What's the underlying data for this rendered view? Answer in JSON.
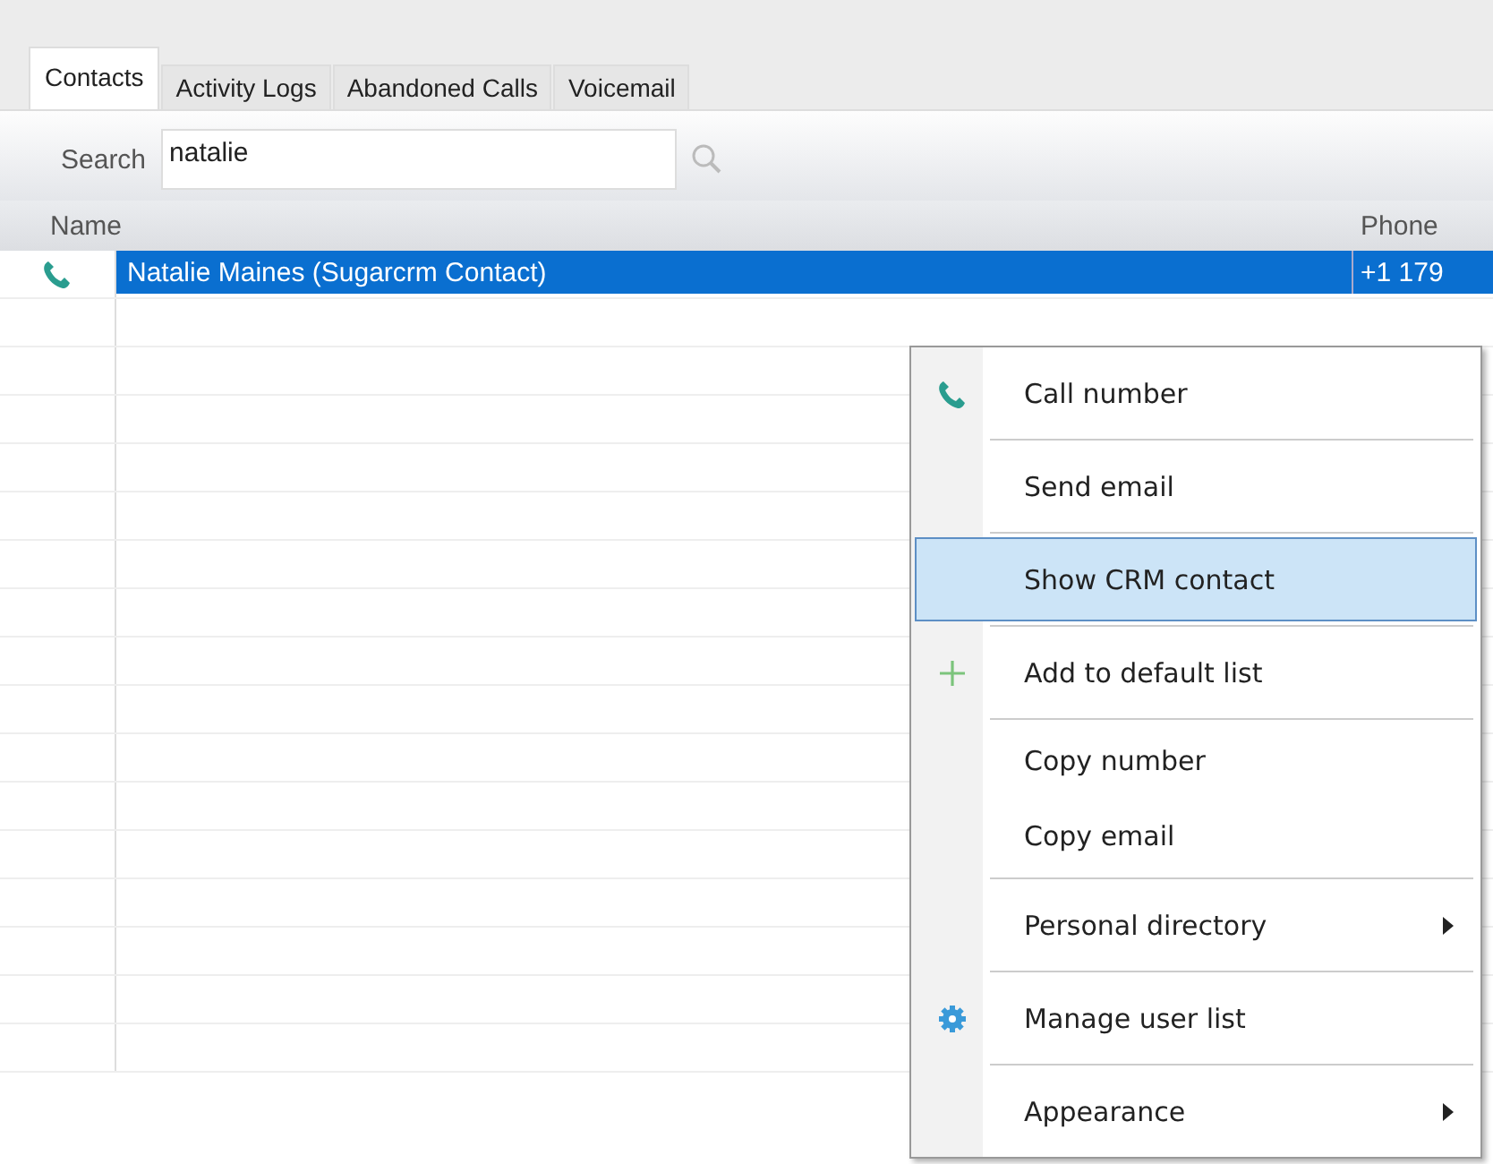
{
  "tabs": [
    {
      "label": "Contacts",
      "selected": true
    },
    {
      "label": "Activity Logs",
      "selected": false
    },
    {
      "label": "Abandoned Calls",
      "selected": false
    },
    {
      "label": "Voicemail",
      "selected": false
    }
  ],
  "search": {
    "label": "Search",
    "value": "natalie"
  },
  "table": {
    "columns": [
      "Name",
      "Phone"
    ],
    "rows": [
      {
        "name": "Natalie Maines (Sugarcrm Contact)",
        "phone": "+1 179",
        "selected": true
      }
    ]
  },
  "context_menu": {
    "groups": [
      [
        {
          "label": "Call number",
          "kind": "phone",
          "selected": false,
          "submenu": false
        }
      ],
      [
        {
          "label": "Send email",
          "kind": "plain",
          "selected": false,
          "submenu": false
        }
      ],
      [
        {
          "label": "Show CRM contact",
          "kind": "plain",
          "selected": true,
          "submenu": false
        }
      ],
      [
        {
          "label": "Add to default list",
          "kind": "plus",
          "selected": false,
          "submenu": false
        }
      ],
      [
        {
          "label": "Copy number",
          "kind": "plain",
          "selected": false,
          "submenu": false
        },
        {
          "label": "Copy email",
          "kind": "plain",
          "selected": false,
          "submenu": false
        }
      ],
      [
        {
          "label": "Personal directory",
          "kind": "plain",
          "selected": false,
          "submenu": true
        }
      ],
      [
        {
          "label": "Manage user list",
          "kind": "gear",
          "selected": false,
          "submenu": false
        }
      ],
      [
        {
          "label": "Appearance",
          "kind": "plain",
          "selected": false,
          "submenu": true
        }
      ]
    ]
  }
}
